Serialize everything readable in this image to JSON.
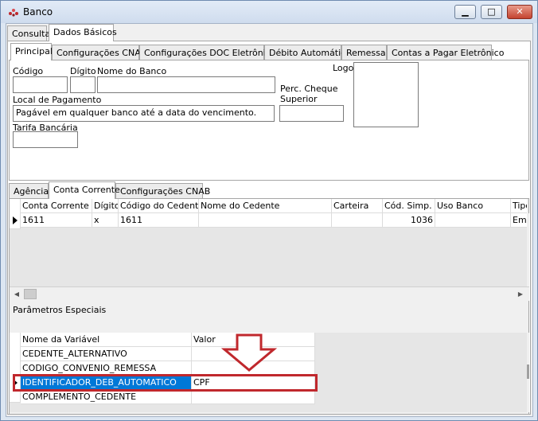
{
  "window": {
    "title": "Banco",
    "minimize_glyph": "▁",
    "maximize_glyph": "□",
    "close_glyph": "✕"
  },
  "main_tabs": [
    "Consulta",
    "Dados Básicos"
  ],
  "sub_tabs": [
    "Principal",
    "Configurações CNAB",
    "Configurações DOC Eletrônico",
    "Débito Automático",
    "Remessa",
    "Contas a Pagar Eletrônico"
  ],
  "form": {
    "codigo_label": "Código",
    "digito_label": "Dígito",
    "nome_banco_label": "Nome do Banco",
    "logo_label": "Logo",
    "perc_cheque_label_1": "Perc. Cheque",
    "perc_cheque_label_2": "Superior",
    "local_pagamento_label": "Local de Pagamento",
    "local_pagamento_value": "Pagável em qualquer banco até a data do vencimento.",
    "tarifa_label": "Tarifa Bancária",
    "codigo_value": "",
    "digito_value": "",
    "nome_banco_value": "",
    "perc_cheque_value": "",
    "tarifa_value": ""
  },
  "lower_tabs": [
    "Agência",
    "Conta Corrente",
    "Configurações CNAB"
  ],
  "accounts_grid": {
    "headers": [
      "Conta Corrente",
      "Dígito",
      "Código do Cedente",
      "Nome do Cedente",
      "Carteira",
      "Cód. Simp.",
      "Uso Banco",
      "Tipo"
    ],
    "row": [
      "1611",
      "x",
      "1611",
      "",
      "",
      "1036",
      "",
      "Emp"
    ]
  },
  "params": {
    "section_label": "Parâmetros Especiais",
    "headers": [
      "Nome da Variável",
      "Valor"
    ],
    "rows": [
      {
        "name": "CEDENTE_ALTERNATIVO",
        "value": ""
      },
      {
        "name": "CODIGO_CONVENIO_REMESSA",
        "value": ""
      },
      {
        "name": "IDENTIFICADOR_DEB_AUTOMATICO",
        "value": "CPF"
      },
      {
        "name": "COMPLEMENTO_CEDENTE",
        "value": ""
      }
    ]
  },
  "colors": {
    "highlight_box": "#c0282d",
    "arrow": "#c0282d",
    "selected_cell": "#0078d7"
  },
  "scroll_glyphs": {
    "left": "◀",
    "right": "▶"
  }
}
